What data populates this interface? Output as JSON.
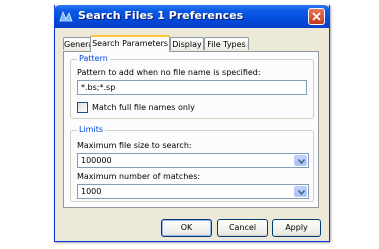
{
  "window": {
    "title": "Search Files 1 Preferences"
  },
  "tabs": [
    {
      "label": "General"
    },
    {
      "label": "Search Parameters"
    },
    {
      "label": "Display"
    },
    {
      "label": "File Types"
    }
  ],
  "pattern_group": {
    "title": "Pattern",
    "field_label": "Pattern to add when no file name is specified:",
    "field_value": "*.bs;*.sp",
    "checkbox_label": "Match full file names only",
    "checkbox_checked": false
  },
  "limits_group": {
    "title": "Limits",
    "max_size_label": "Maximum file size to search:",
    "max_size_value": "100000",
    "max_matches_label": "Maximum number of matches:",
    "max_matches_value": "1000"
  },
  "buttons": {
    "ok": "OK",
    "cancel": "Cancel",
    "apply": "Apply"
  },
  "colors": {
    "titlebar": "#0348d8",
    "group_label": "#0046d5",
    "active_tab_accent": "#ffc83c"
  }
}
